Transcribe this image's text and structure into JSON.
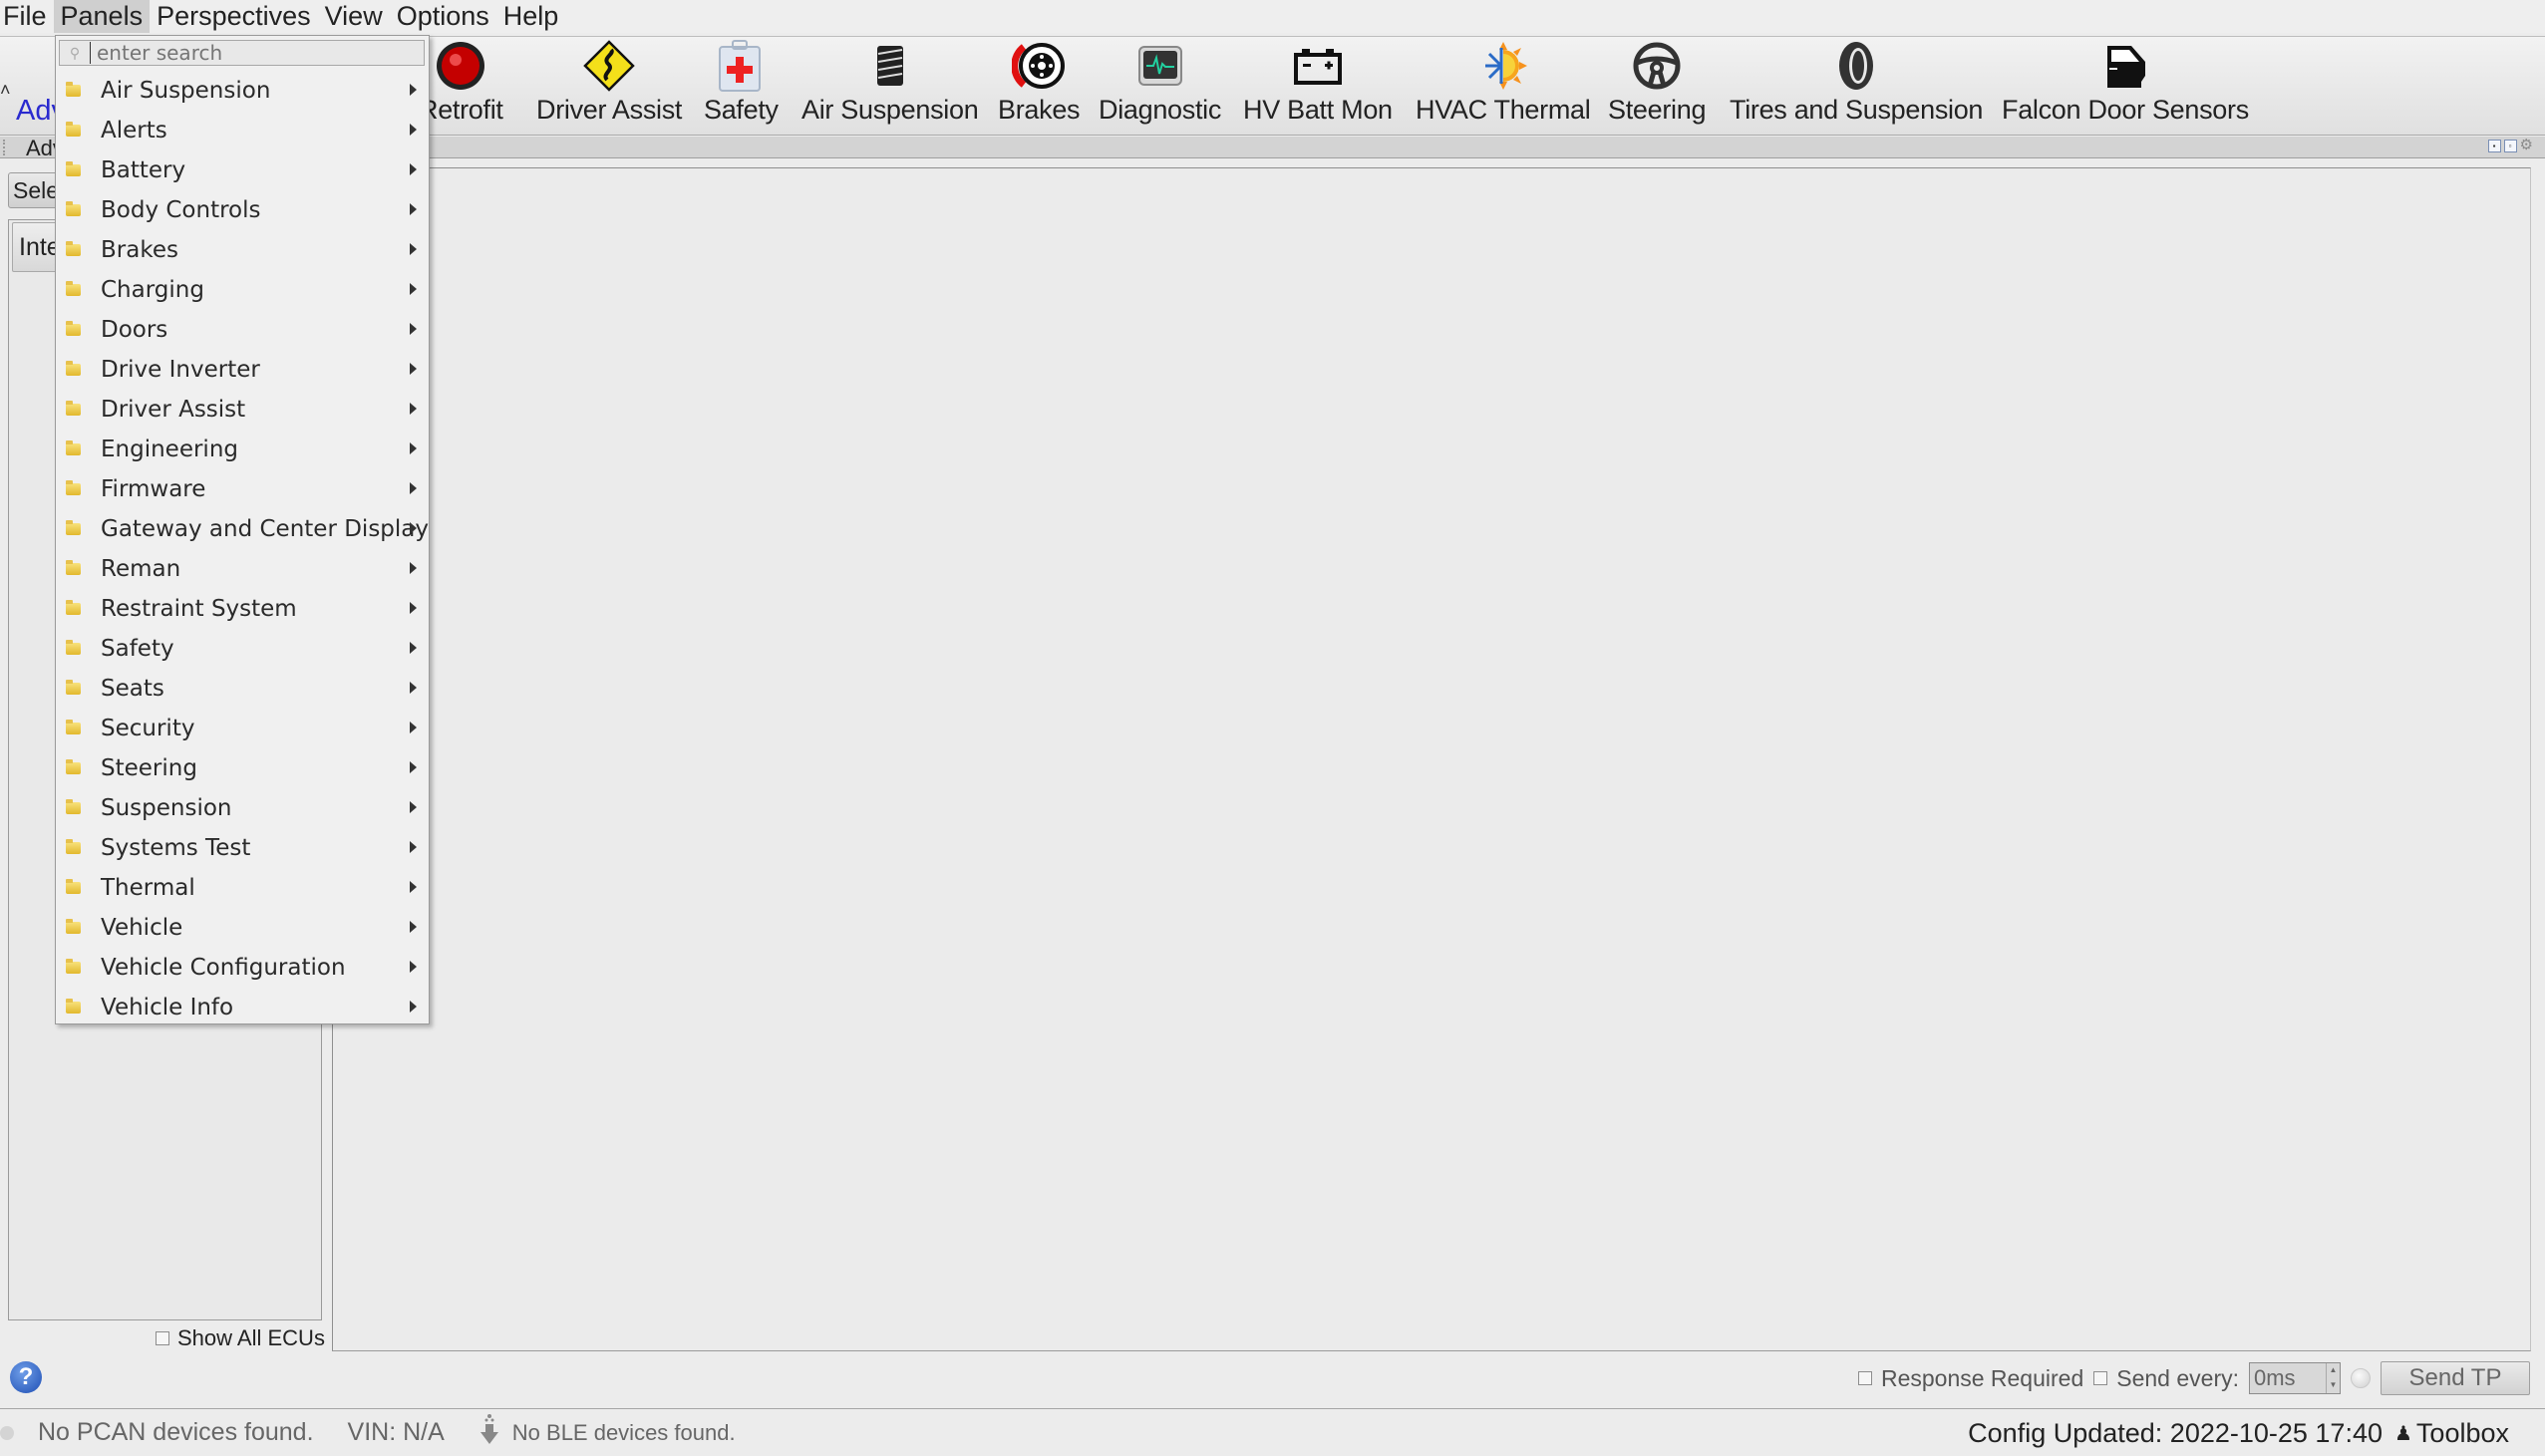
{
  "menubar": {
    "items": [
      "File",
      "Panels",
      "Perspectives",
      "View",
      "Options",
      "Help"
    ],
    "active": "Panels"
  },
  "toolbar": {
    "advanced_label": "Adv",
    "items": [
      {
        "label": "Retrofit",
        "icon": "retrofit-red-light-icon"
      },
      {
        "label": "Driver Assist",
        "icon": "winding-road-sign-icon"
      },
      {
        "label": "Safety",
        "icon": "first-aid-kit-icon"
      },
      {
        "label": "Air Suspension",
        "icon": "spring-coil-icon"
      },
      {
        "label": "Brakes",
        "icon": "brake-disc-icon"
      },
      {
        "label": "Diagnostic",
        "icon": "heartbeat-monitor-icon"
      },
      {
        "label": "HV Batt Mon",
        "icon": "battery-icon"
      },
      {
        "label": "HVAC Thermal",
        "icon": "snowflake-sun-icon"
      },
      {
        "label": "Steering",
        "icon": "steering-wheel-icon"
      },
      {
        "label": "Tires and Suspension",
        "icon": "tire-icon"
      },
      {
        "label": "Falcon Door Sensors",
        "icon": "car-door-icon"
      }
    ]
  },
  "dock": {
    "title": "Adv"
  },
  "left_panel": {
    "select_button": "Sele",
    "list_header": "Inte",
    "show_all_ecus": "Show All ECUs",
    "show_all_checked": false
  },
  "send_row": {
    "response_required": "Response Required",
    "response_required_checked": false,
    "send_every_label": "Send every:",
    "send_every_checked": false,
    "send_every_value": "0ms",
    "send_button": "Send TP"
  },
  "statusbar": {
    "pcan": "No PCAN devices found.",
    "vin": "VIN: N/A",
    "ble": "No BLE devices found.",
    "config": "Config Updated: 2022-10-25 17:40",
    "user": "Toolbox"
  },
  "panels_menu": {
    "search_placeholder": "enter search",
    "items": [
      "Air Suspension",
      "Alerts",
      "Battery",
      "Body Controls",
      "Brakes",
      "Charging",
      "Doors",
      "Drive Inverter",
      "Driver Assist",
      "Engineering",
      "Firmware",
      "Gateway and Center Display",
      "Reman",
      "Restraint System",
      "Safety",
      "Seats",
      "Security",
      "Steering",
      "Suspension",
      "Systems Test",
      "Thermal",
      "Vehicle",
      "Vehicle Configuration",
      "Vehicle Info"
    ]
  },
  "colors": {
    "link_blue": "#2a2acf",
    "brake_red": "#e01010",
    "diag_green": "#22d0a0",
    "folder_yellow": "#e8c13a"
  }
}
